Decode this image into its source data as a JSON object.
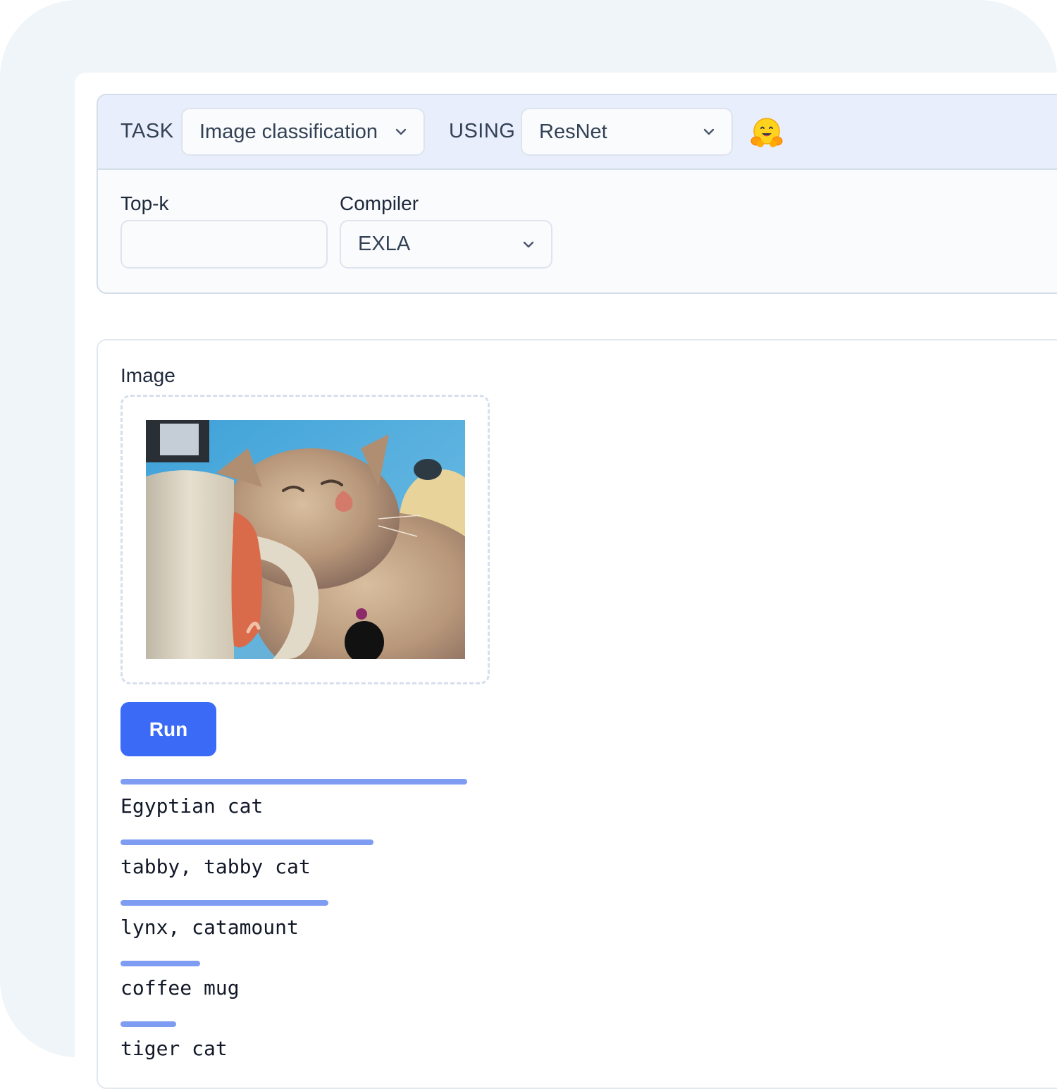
{
  "header": {
    "task_label": "TASK",
    "task_value": "Image classification",
    "using_label": "USING",
    "using_value": "ResNet",
    "logo_icon": "hugging-face-icon"
  },
  "options": {
    "topk_label": "Top-k",
    "topk_value": "",
    "compiler_label": "Compiler",
    "compiler_value": "EXLA"
  },
  "input": {
    "image_label": "Image",
    "image_description_icon": "cat-photo"
  },
  "run_label": "Run",
  "results": [
    {
      "label": "Egyptian cat",
      "score": 1.0
    },
    {
      "label": "tabby, tabby cat",
      "score": 0.73
    },
    {
      "label": "lynx, catamount",
      "score": 0.6
    },
    {
      "label": "coffee mug",
      "score": 0.23
    },
    {
      "label": "tiger cat",
      "score": 0.16
    }
  ],
  "colors": {
    "accent": "#3b6af7",
    "bar": "#7e9cf2",
    "header_bg": "#e8eefb"
  }
}
